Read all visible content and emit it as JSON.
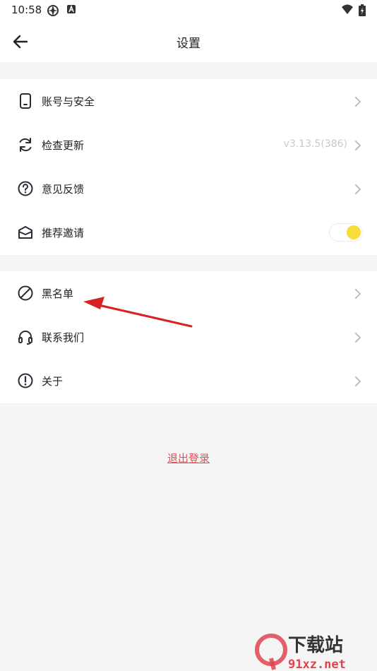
{
  "status_bar": {
    "time": "10:58"
  },
  "header": {
    "title": "设置"
  },
  "group1": [
    {
      "label": "账号与安全",
      "icon": "phone-icon"
    },
    {
      "label": "检查更新",
      "value": "v3.13.5(386)",
      "icon": "refresh-icon"
    },
    {
      "label": "意见反馈",
      "icon": "question-circle-icon"
    },
    {
      "label": "推荐邀请",
      "icon": "mail-icon",
      "toggle_on": true
    }
  ],
  "group2": [
    {
      "label": "黑名单",
      "icon": "block-icon"
    },
    {
      "label": "联系我们",
      "icon": "headset-icon"
    },
    {
      "label": "关于",
      "icon": "info-circle-icon"
    }
  ],
  "logout_label": "退出登录",
  "watermark": {
    "brand": "下载站",
    "site": "91xz.net"
  },
  "colors": {
    "accent_yellow": "#f7dd39",
    "logout_red": "#e3504f",
    "annotation_red": "#d62222"
  }
}
